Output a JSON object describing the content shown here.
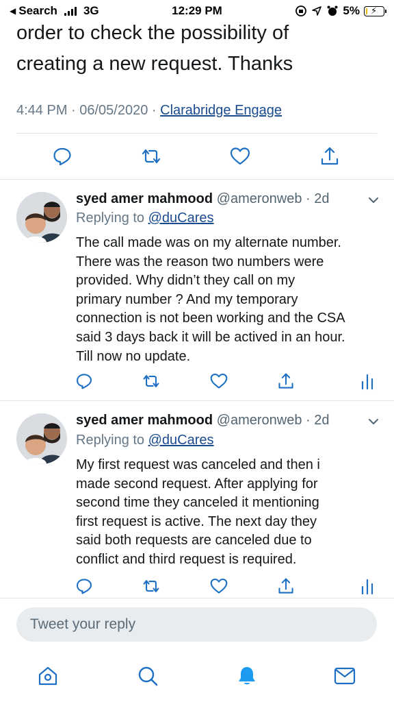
{
  "status_bar": {
    "back_label": "Search",
    "network": "3G",
    "time": "12:29 PM",
    "battery_percent": "5%",
    "battery_level": 0.05,
    "battery_color": "#f2b705"
  },
  "main_tweet": {
    "text_lines": [
      "order to check the possibility of",
      "creating a new request. Thanks"
    ],
    "timestamp": "4:44 PM · 06/05/2020 · ",
    "source": "Clarabridge Engage",
    "actions": [
      "reply-icon",
      "retweet-icon",
      "like-icon",
      "share-icon"
    ]
  },
  "replies": [
    {
      "name": "syed amer mahmood",
      "handle": "@ameronweb · 2d",
      "replying_prefix": "Replying to ",
      "replying_to": "@duCares",
      "text_lines": [
        "The call made was on my alternate number.",
        "There was the reason two numbers were",
        "provided. Why didn’t they call on my",
        "primary number ? And my temporary",
        "connection is not been working and the CSA",
        "said 3 days back it will be actived in an hour.",
        "Till now no update."
      ]
    },
    {
      "name": "syed amer mahmood",
      "handle": "@ameronweb · 2d",
      "replying_prefix": "Replying to ",
      "replying_to": "@duCares",
      "text_lines": [
        "My first request was canceled and then i",
        "made second request. After applying for",
        "second time they canceled it mentioning",
        "first request is active. The next day they",
        "said both requests are canceled due to",
        "conflict and third request is required."
      ]
    }
  ],
  "compose": {
    "placeholder": "Tweet your reply"
  },
  "tabbar": {
    "items": [
      "home-icon",
      "search-icon",
      "notifications-icon",
      "messages-icon"
    ],
    "active": "notifications-icon",
    "active_color": "#1d9bf0"
  },
  "colors": {
    "link": "#1b4b8f",
    "secondary_text": "#657786",
    "icon": "#1d6fc4"
  }
}
